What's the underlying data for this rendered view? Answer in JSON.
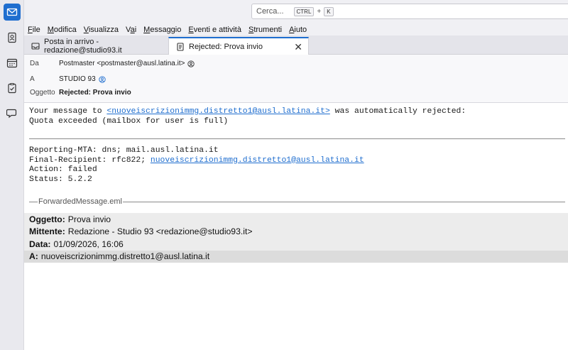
{
  "search": {
    "placeholder": "Cerca...",
    "key1": "CTRL",
    "plus": "+",
    "key2": "K"
  },
  "menu": [
    "File",
    "Modifica",
    "Visualizza",
    "Vai",
    "Messaggio",
    "Eventi e attività",
    "Strumenti",
    "Aiuto"
  ],
  "tabs": [
    {
      "label": "Posta in arrivo - redazione@studio93.it",
      "icon": "inbox-icon"
    },
    {
      "label": "Rejected: Prova invio",
      "icon": "message-icon",
      "active": true
    }
  ],
  "header": {
    "from_label": "Da",
    "from_value": "Postmaster <postmaster@ausl.latina.it>",
    "to_label": "A",
    "to_value": "STUDIO 93",
    "subject_label": "Oggetto",
    "subject_value": "Rejected: Prova invio"
  },
  "body": {
    "line1_pre": "Your message to ",
    "line1_link": "<nuoveiscrizionimmg.distretto1@ausl.latina.it>",
    "line1_post": " was automatically rejected:",
    "line2": "Quota exceeded (mailbox for user is full)",
    "reporting_mta": "Reporting-MTA: dns; mail.ausl.latina.it",
    "final_recipient_pre": "Final-Recipient: rfc822; ",
    "final_recipient_link": "nuoveiscrizionimmg.distretto1@ausl.latina.it",
    "action": "Action: failed",
    "status": "Status: 5.2.2"
  },
  "forwarded": {
    "label": "ForwardedMessage.eml",
    "subject_label": "Oggetto:",
    "subject_value": "Prova invio",
    "sender_label": "Mittente:",
    "sender_value": "Redazione - Studio 93 <redazione@studio93.it>",
    "date_label": "Data:",
    "date_value": "01/09/2026, 16:06",
    "to_label": "A:",
    "to_value": "nuoveiscrizionimmg.distretto1@ausl.latina.it"
  },
  "colors": {
    "accent": "#1f6ecf",
    "link": "#1f6ecf"
  }
}
